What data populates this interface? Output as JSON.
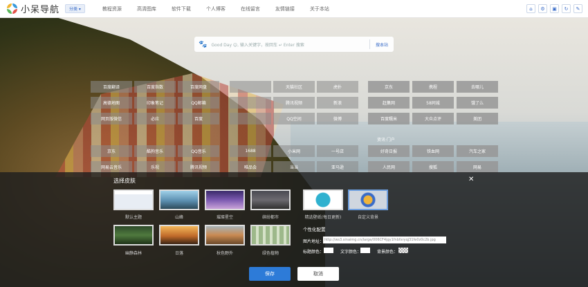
{
  "header": {
    "site_name": "小呆导航",
    "category_label": "分类 ▾",
    "nav": [
      "教程资源",
      "高清图库",
      "软件下载",
      "个人博客",
      "在线留言",
      "友情链接",
      "关于本站"
    ],
    "tools": [
      "home-icon",
      "gear-icon",
      "image-icon",
      "refresh-icon",
      "edit-icon"
    ]
  },
  "search": {
    "placeholder": "Good Day ☺, 输入关键字，按回车 ↵ Enter 搜索",
    "button": "搜本站"
  },
  "links": {
    "left_rows": [
      [
        "百度翻译",
        "百度指数",
        "百度网盘",
        "",
        "天猫社区",
        "虎扑"
      ],
      [
        "高德地图",
        "印象笔记",
        "QQ邮箱",
        "",
        "腾讯视频",
        "新浪"
      ],
      [
        "网页版微信",
        "必应",
        "百度",
        "",
        "QQ空间",
        "微博"
      ]
    ],
    "right_rows": [
      [
        "京东",
        "携程",
        "去哪儿"
      ],
      [
        "赶集网",
        "58同城",
        "饿了么"
      ],
      [
        "百度糯米",
        "大众点评",
        "美团"
      ]
    ],
    "lower_rows": [
      [
        "京东",
        "酷狗音乐",
        "QQ音乐",
        "1688",
        "小米网",
        "一号店"
      ],
      [
        "网易云音乐",
        "乐视",
        "腾讯视频",
        "唯品会",
        "当当",
        "亚马逊"
      ]
    ],
    "lower_right": [
      [
        "好奇日报",
        "铁血网",
        "汽车之家"
      ],
      [
        "人民网",
        "搜狐",
        "网易"
      ]
    ],
    "group_titles": [
      "资讯·门户"
    ]
  },
  "skin_modal": {
    "title": "选择皮肤",
    "close": "✕",
    "themes_row1": [
      {
        "label": "默认主题"
      },
      {
        "label": "山峰"
      },
      {
        "label": "璀璨星空"
      },
      {
        "label": "缤纷都市"
      }
    ],
    "themes_row2": [
      {
        "label": "幽静森林"
      },
      {
        "label": "日落"
      },
      {
        "label": "秋色野外"
      },
      {
        "label": "绿色植物"
      }
    ],
    "special": [
      {
        "label": "精选壁纸(每日更新)"
      },
      {
        "label": "自定义背景"
      }
    ],
    "personal_title": "个性化配置",
    "image_url_label": "图片地址：",
    "image_url_value": "http://ws3.sinaimg.cn/large/006CF4jgy1fnbfxryqj31fe0z0c2b.jpg",
    "title_color_label": "标题颜色：",
    "text_color_label": "文字颜色：",
    "bg_color_label": "背景颜色：",
    "save": "保存",
    "cancel": "取消"
  }
}
